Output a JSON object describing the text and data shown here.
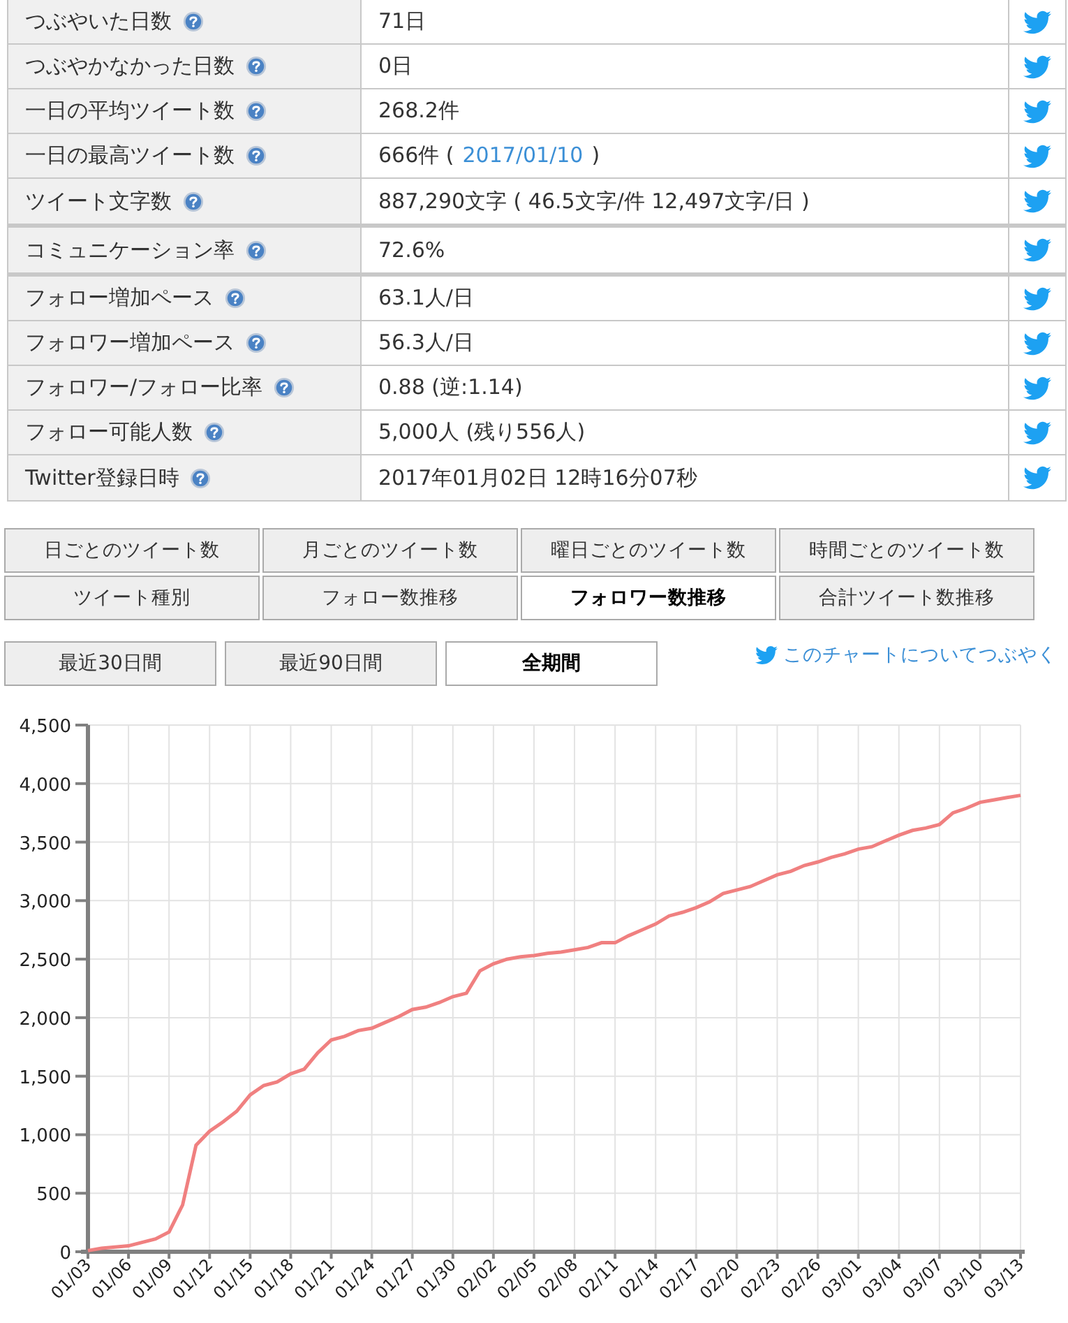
{
  "stat_groups": [
    {
      "rows": [
        {
          "label": "つぶやいた日数",
          "value": "71日"
        },
        {
          "label": "つぶやかなかった日数",
          "value": "0日"
        },
        {
          "label": "一日の平均ツイート数",
          "value": "268.2件"
        },
        {
          "label": "一日の最高ツイート数",
          "value": "666件 (",
          "link": "2017/01/10",
          "value_after": ")"
        },
        {
          "label": "ツイート文字数",
          "value": "887,290文字 ( 46.5文字/件 12,497文字/日 )"
        }
      ]
    },
    {
      "rows": [
        {
          "label": "コミュニケーション率",
          "value": "72.6%"
        }
      ]
    },
    {
      "rows": [
        {
          "label": "フォロー増加ペース",
          "value": "63.1人/日"
        },
        {
          "label": "フォロワー増加ペース",
          "value": "56.3人/日"
        },
        {
          "label": "フォロワー/フォロー比率",
          "value": "0.88 (逆:1.14)"
        },
        {
          "label": "フォロー可能人数",
          "value": "5,000人 (残り556人)"
        },
        {
          "label": "Twitter登録日時",
          "value": "2017年01月02日 12時16分07秒"
        }
      ]
    }
  ],
  "chart_tabs": [
    {
      "label": "日ごとのツイート数",
      "selected": false
    },
    {
      "label": "月ごとのツイート数",
      "selected": false
    },
    {
      "label": "曜日ごとのツイート数",
      "selected": false
    },
    {
      "label": "時間ごとのツイート数",
      "selected": false
    },
    {
      "label": "ツイート種別",
      "selected": false
    },
    {
      "label": "フォロー数推移",
      "selected": false
    },
    {
      "label": "フォロワー数推移",
      "selected": true
    },
    {
      "label": "合計ツイート数推移",
      "selected": false
    }
  ],
  "period_tabs": [
    {
      "label": "最近30日間",
      "selected": false
    },
    {
      "label": "最近90日間",
      "selected": false
    },
    {
      "label": "全期間",
      "selected": true
    }
  ],
  "tweet_chart_link": "このチャートについてつぶやく",
  "chart_data": {
    "type": "line",
    "categories": [
      "01/03",
      null,
      null,
      "01/06",
      null,
      null,
      "01/09",
      null,
      null,
      "01/12",
      null,
      null,
      "01/15",
      null,
      null,
      "01/18",
      null,
      null,
      "01/21",
      null,
      null,
      "01/24",
      null,
      null,
      "01/27",
      null,
      null,
      "01/30",
      null,
      null,
      "02/02",
      null,
      null,
      "02/05",
      null,
      null,
      "02/08",
      null,
      null,
      "02/11",
      null,
      null,
      "02/14",
      null,
      null,
      "02/17",
      null,
      null,
      "02/20",
      null,
      null,
      "02/23",
      null,
      null,
      "02/26",
      null,
      null,
      "03/01",
      null,
      null,
      "03/04",
      null,
      null,
      "03/07",
      null,
      null,
      "03/10",
      null,
      null,
      "03/13"
    ],
    "series": [
      {
        "color": "#f08080",
        "values": [
          10,
          30,
          40,
          50,
          80,
          110,
          170,
          400,
          910,
          1030,
          1110,
          1200,
          1340,
          1420,
          1450,
          1520,
          1560,
          1700,
          1810,
          1840,
          1890,
          1910,
          1960,
          2010,
          2070,
          2090,
          2130,
          2180,
          2210,
          2400,
          2460,
          2500,
          2520,
          2530,
          2550,
          2560,
          2580,
          2600,
          2640,
          2640,
          2700,
          2750,
          2800,
          2870,
          2900,
          2940,
          2990,
          3060,
          3090,
          3120,
          3170,
          3220,
          3250,
          3300,
          3330,
          3370,
          3400,
          3440,
          3460,
          3510,
          3560,
          3600,
          3620,
          3650,
          3750,
          3790,
          3840,
          3860,
          3880,
          3900
        ]
      }
    ],
    "ylim": [
      0,
      4500
    ],
    "grid": true,
    "yticks": [
      {
        "value": 0,
        "label": "0"
      },
      {
        "value": 500,
        "label": "500"
      },
      {
        "value": 1000,
        "label": "1,000"
      },
      {
        "value": 1500,
        "label": "1,500"
      },
      {
        "value": 2000,
        "label": "2,000"
      },
      {
        "value": 2500,
        "label": "2,500"
      },
      {
        "value": 3000,
        "label": "3,000"
      },
      {
        "value": 3500,
        "label": "3,500"
      },
      {
        "value": 4000,
        "label": "4,000"
      },
      {
        "value": 4500,
        "label": "4,500"
      }
    ]
  }
}
